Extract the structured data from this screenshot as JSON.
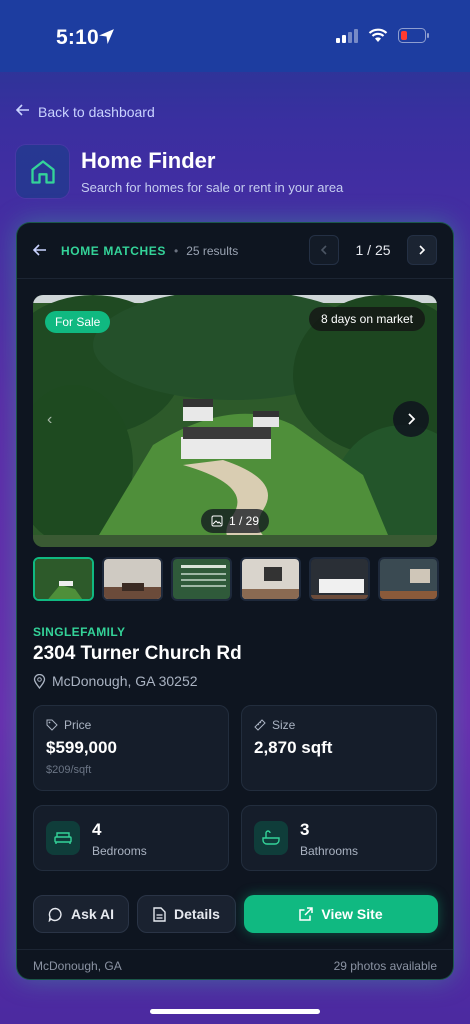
{
  "status_bar": {
    "time": "5:10"
  },
  "nav": {
    "back_label": "Back to dashboard"
  },
  "app": {
    "title": "Home Finder",
    "subtitle": "Search for homes for sale or rent in your area"
  },
  "matches": {
    "label": "HOME MATCHES",
    "separator": "•",
    "count": "25 results",
    "page": "1 / 25"
  },
  "listing": {
    "status_badge": "For Sale",
    "days_on_market": "8 days on market",
    "photo_index": "1 / 29",
    "type": "SINGLEFAMILY",
    "address": "2304 Turner Church Rd",
    "city": "McDonough, GA 30252",
    "price_label": "Price",
    "price": "$599,000",
    "price_per_sqft": "$209/sqft",
    "size_label": "Size",
    "size": "2,870 sqft",
    "bedrooms": "4",
    "bedrooms_label": "Bedrooms",
    "bathrooms": "3",
    "bathrooms_label": "Bathrooms"
  },
  "actions": {
    "ask_ai": "Ask AI",
    "details": "Details",
    "view_site": "View Site"
  },
  "footer": {
    "location": "McDonough, GA",
    "photos": "29 photos available"
  },
  "colors": {
    "accent": "#10b981",
    "accent_text": "#34d399",
    "card_bg": "#0e1520"
  }
}
